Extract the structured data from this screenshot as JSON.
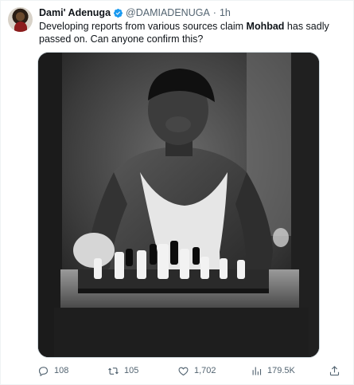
{
  "tweet": {
    "author": {
      "display_name": "Dami' Adenuga",
      "handle": "@DAMIADENUGA",
      "separator": "·",
      "time": "1h",
      "verified_color": "#1d9bf0"
    },
    "text": {
      "part1": "Developing reports from various sources claim ",
      "highlight": "Mohbad",
      "part2": " has sadly passed on. Can anyone confirm this?"
    },
    "media": {
      "description": "Black and white photo of a man in a tank top and durag playing chess"
    },
    "actions": {
      "replies": "108",
      "retweets": "105",
      "likes": "1,702",
      "views": "179.5K"
    },
    "icons": {
      "reply": "reply-icon",
      "retweet": "retweet-icon",
      "like": "heart-icon",
      "views": "views-icon",
      "share": "share-icon",
      "verified": "verified-badge-icon"
    }
  }
}
